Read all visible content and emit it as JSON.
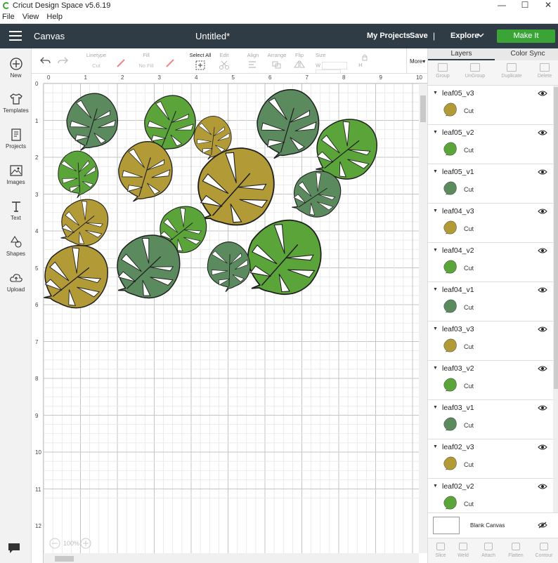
{
  "window": {
    "title": "Cricut Design Space  v5.6.19"
  },
  "menu": [
    "File",
    "View",
    "Help"
  ],
  "header": {
    "section": "Canvas",
    "doc_title": "Untitled*",
    "my_projects": "My Projects",
    "save": "Save",
    "separator": "|",
    "explore": "Explore",
    "make_it": "Make It"
  },
  "left_tools": [
    "New",
    "Templates",
    "Projects",
    "Images",
    "Text",
    "Shapes",
    "Upload"
  ],
  "toolbar": {
    "linetype_label": "Linetype",
    "linetype_value": "Cut",
    "fill_label": "Fill",
    "fill_value": "No Fill",
    "select_all": "Select All",
    "edit": "Edit",
    "align": "Align",
    "arrange": "Arrange",
    "flip": "Flip",
    "size": "Size",
    "w_label": "W",
    "h_label": "H",
    "more": "More▾"
  },
  "ruler_top": [
    "0",
    "1",
    "2",
    "3",
    "4",
    "5",
    "6",
    "7",
    "8",
    "9",
    "10"
  ],
  "ruler_left": [
    "0",
    "1",
    "2",
    "3",
    "4",
    "5",
    "6",
    "7",
    "8",
    "9",
    "10",
    "11",
    "12"
  ],
  "zoom": {
    "value": "100%"
  },
  "panel": {
    "tabs": [
      "Layers",
      "Color Sync"
    ],
    "layer_tools": [
      "Group",
      "UnGroup",
      "Duplicate",
      "Delete"
    ],
    "layers": [
      {
        "name": "leaf05_v3",
        "op": "Cut",
        "color": "#b29a36"
      },
      {
        "name": "leaf05_v2",
        "op": "Cut",
        "color": "#5aa43a"
      },
      {
        "name": "leaf05_v1",
        "op": "Cut",
        "color": "#5b8a5e"
      },
      {
        "name": "leaf04_v3",
        "op": "Cut",
        "color": "#b29a36"
      },
      {
        "name": "leaf04_v2",
        "op": "Cut",
        "color": "#5aa43a"
      },
      {
        "name": "leaf04_v1",
        "op": "Cut",
        "color": "#5b8a5e"
      },
      {
        "name": "leaf03_v3",
        "op": "Cut",
        "color": "#b29a36"
      },
      {
        "name": "leaf03_v2",
        "op": "Cut",
        "color": "#5aa43a"
      },
      {
        "name": "leaf03_v1",
        "op": "Cut",
        "color": "#5b8a5e"
      },
      {
        "name": "leaf02_v3",
        "op": "Cut",
        "color": "#b29a36"
      },
      {
        "name": "leaf02_v2",
        "op": "Cut",
        "color": "#5aa43a"
      }
    ],
    "blank_canvas": "Blank Canvas",
    "bottom_tools": [
      "Slice",
      "Weld",
      "Attach",
      "Flatten",
      "Contour"
    ]
  },
  "colors": {
    "gold": "#b29a36",
    "green": "#5aa43a",
    "sage": "#5b8a5e",
    "accent": "#3aa536",
    "header": "#2f3b45"
  }
}
